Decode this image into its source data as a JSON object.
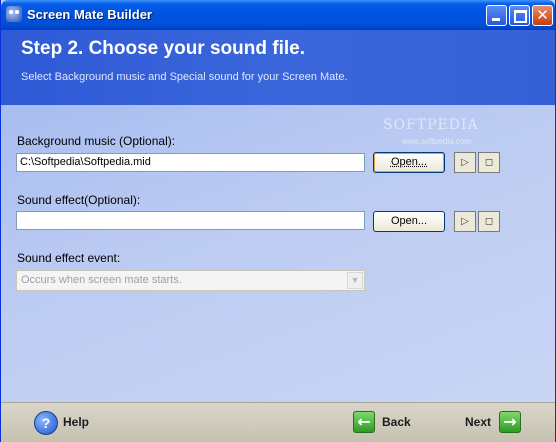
{
  "window": {
    "title": "Screen Mate Builder",
    "icon": "app-icon",
    "controls": [
      "minimize-icon",
      "maximize-icon",
      "close-icon"
    ]
  },
  "header": {
    "title": "Step 2. Choose your sound file.",
    "subtitle": "Select Background music and Special sound for your Screen Mate."
  },
  "background_music": {
    "label": "Background music (Optional):",
    "value": "C:\\Softpedia\\Softpedia.mid",
    "open_label": "Open...",
    "play_icon": "play-icon",
    "stop_icon": "stop-icon"
  },
  "sound_effect": {
    "label": "Sound effect(Optional):",
    "value": "",
    "open_label": "Open...",
    "play_icon": "play-icon",
    "stop_icon": "stop-icon"
  },
  "sound_event": {
    "label": "Sound effect event:",
    "selected": "Occurs when screen mate starts."
  },
  "watermark": {
    "text": "SOFTPEDIA",
    "sub": "www.softpedia.com"
  },
  "footer": {
    "help": "Help",
    "back": "Back",
    "next": "Next"
  },
  "colors": {
    "titlebar": "#0054e3",
    "header": "#3560d6",
    "content": "#bccbf2",
    "footer": "#d4d0c8"
  }
}
